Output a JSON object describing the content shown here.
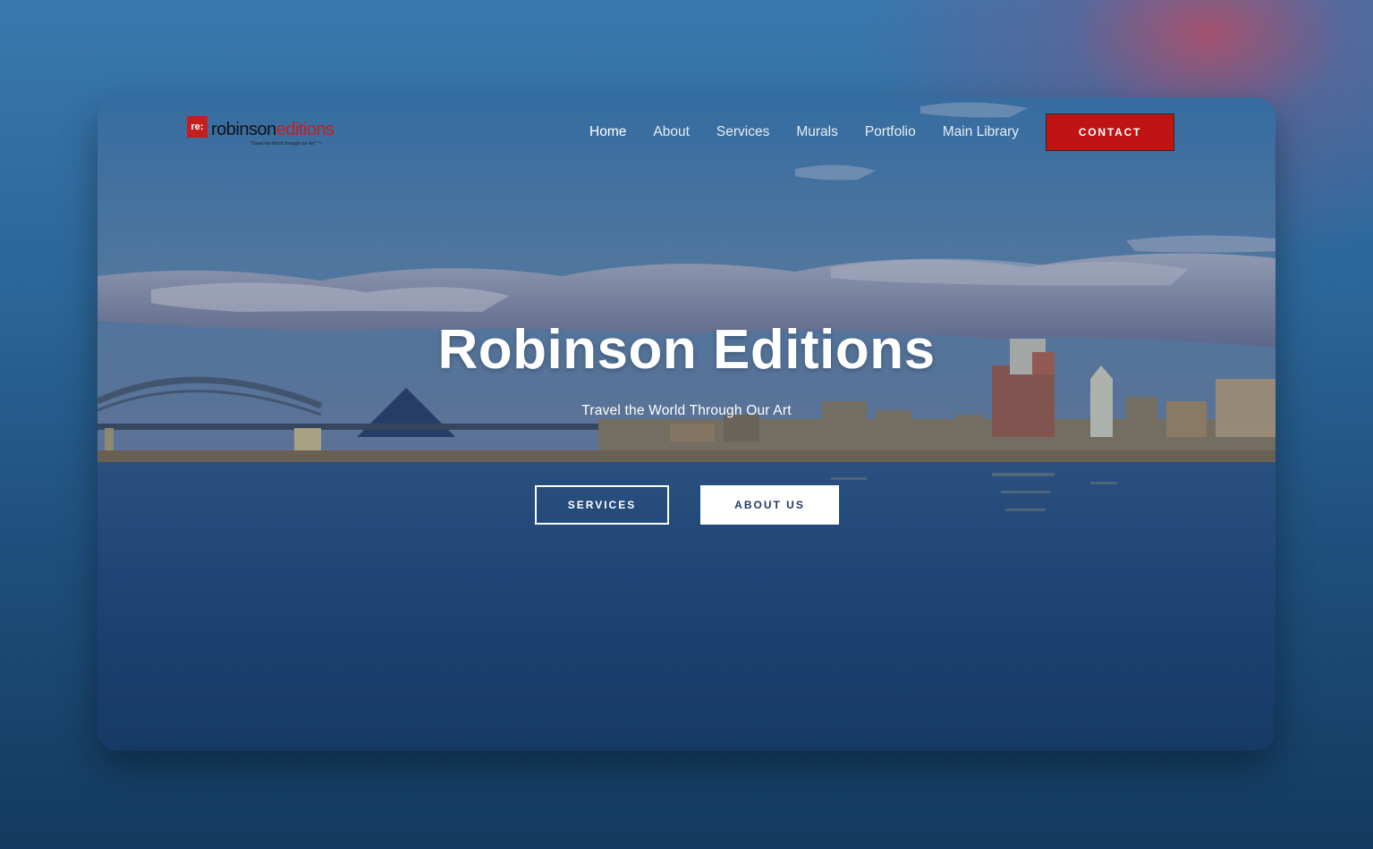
{
  "brand": {
    "badge": "re:",
    "name_main": "robinson",
    "name_accent": "editions",
    "tagline": "\"Travel the World through our Art\" ™"
  },
  "nav": {
    "items": [
      {
        "label": "Home"
      },
      {
        "label": "About"
      },
      {
        "label": "Services"
      },
      {
        "label": "Murals"
      },
      {
        "label": "Portfolio"
      },
      {
        "label": "Main Library"
      }
    ],
    "contact_label": "CONTACT"
  },
  "hero": {
    "title": "Robinson Editions",
    "subtitle": "Travel the World Through Our Art",
    "primary_button": "SERVICES",
    "secondary_button": "ABOUT US"
  },
  "colors": {
    "accent": "#c01414",
    "background": "#2c6597",
    "water": "#1f4676"
  }
}
